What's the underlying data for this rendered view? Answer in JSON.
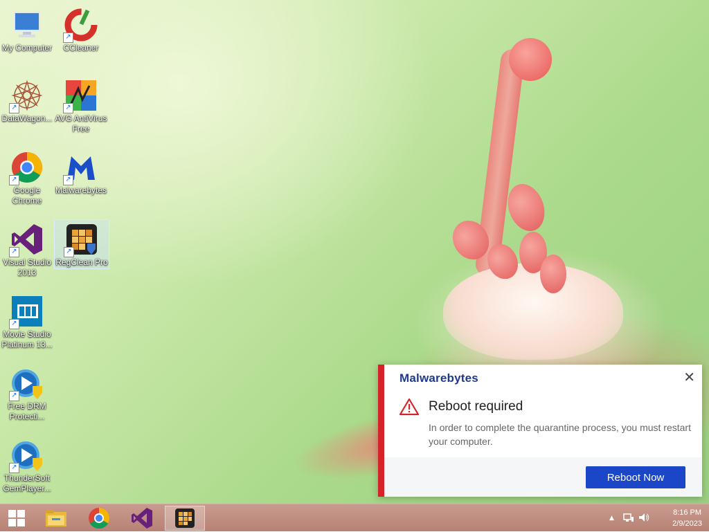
{
  "desktop": {
    "icons": [
      {
        "label": "My Computer"
      },
      {
        "label": "CCleaner"
      },
      {
        "label": "DataWagon..."
      },
      {
        "label": "AVG AntiVirus Free"
      },
      {
        "label": "Google Chrome"
      },
      {
        "label": "Malwarebytes"
      },
      {
        "label": "Visual Studio 2013"
      },
      {
        "label": "RegClean Pro"
      },
      {
        "label": "Movie Studio Platinum 13..."
      },
      {
        "label": "Free DRM Protecti..."
      },
      {
        "label": "ThunderSoft GemPlayer..."
      }
    ]
  },
  "toast": {
    "brand": "Malwarebytes",
    "title": "Reboot required",
    "message": "In order to complete the quarantine process, you must restart your computer.",
    "button_label": "Reboot Now",
    "close_label": "✕",
    "accent_color": "#d6232a",
    "button_color": "#1c46c8"
  },
  "taskbar": {
    "clock_time": "8:16 PM",
    "clock_date": "2/9/2023",
    "tray_up_arrow": "▲"
  }
}
